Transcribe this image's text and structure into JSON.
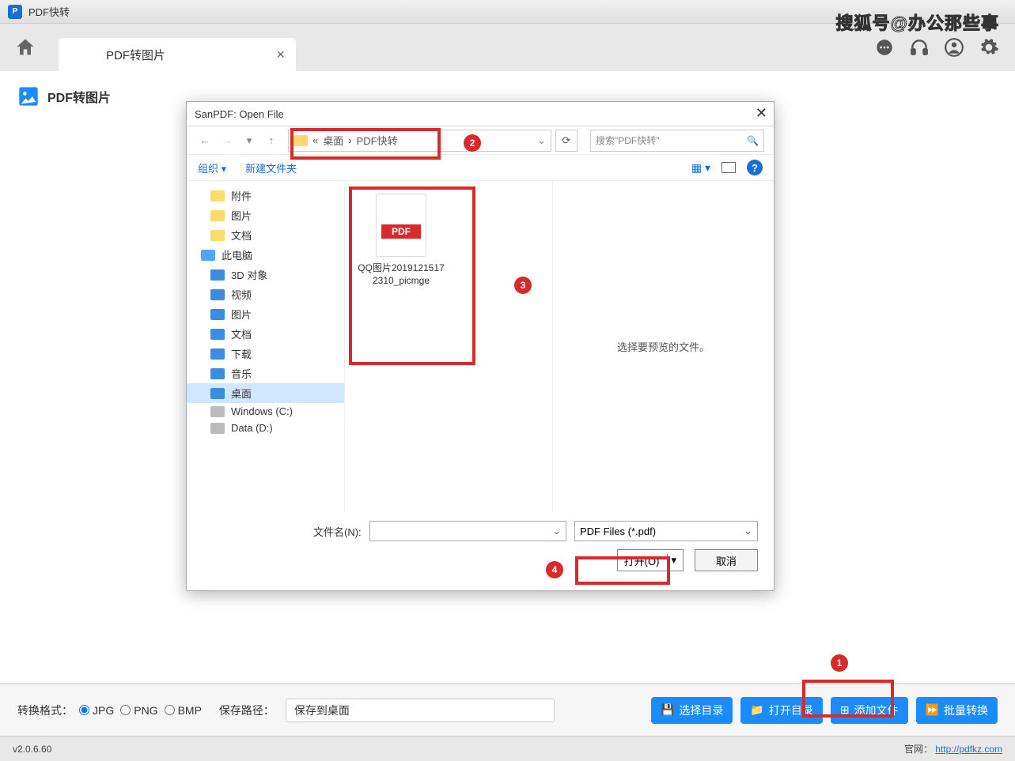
{
  "app": {
    "title": "PDF快转"
  },
  "watermark": "搜狐号@办公那些事",
  "tab": {
    "label": "PDF转图片"
  },
  "section": {
    "title": "PDF转图片"
  },
  "toolbar_icons": [
    "chat",
    "headphones",
    "user",
    "gear"
  ],
  "dialog": {
    "title": "SanPDF: Open File",
    "breadcrumb": {
      "prefix": "«",
      "parts": [
        "桌面",
        "PDF快转"
      ]
    },
    "search_placeholder": "搜索\"PDF快转\"",
    "organize": "组织",
    "new_folder": "新建文件夹",
    "tree": [
      {
        "label": "附件",
        "icon": "folder",
        "level": 1
      },
      {
        "label": "图片",
        "icon": "folder",
        "level": 1
      },
      {
        "label": "文档",
        "icon": "folder",
        "level": 1
      },
      {
        "label": "此电脑",
        "icon": "pc",
        "level": 0
      },
      {
        "label": "3D 对象",
        "icon": "blue",
        "level": 1
      },
      {
        "label": "视频",
        "icon": "blue",
        "level": 1
      },
      {
        "label": "图片",
        "icon": "blue",
        "level": 1
      },
      {
        "label": "文档",
        "icon": "blue",
        "level": 1
      },
      {
        "label": "下载",
        "icon": "blue",
        "level": 1
      },
      {
        "label": "音乐",
        "icon": "blue",
        "level": 1
      },
      {
        "label": "桌面",
        "icon": "mon",
        "level": 1,
        "selected": true
      },
      {
        "label": "Windows (C:)",
        "icon": "drv",
        "level": 1
      },
      {
        "label": "Data (D:)",
        "icon": "drv",
        "level": 1
      }
    ],
    "file": {
      "name": "QQ图片20191215172310_picmge"
    },
    "preview_msg": "选择要预览的文件。",
    "filename_label": "文件名(N):",
    "filetype": "PDF Files (*.pdf)",
    "open_btn": "打开(O)",
    "cancel_btn": "取消"
  },
  "bottom": {
    "format_label": "转换格式：",
    "formats": [
      "JPG",
      "PNG",
      "BMP"
    ],
    "save_label": "保存路径：",
    "save_value": "保存到桌面",
    "buttons": {
      "choose_dir": "选择目录",
      "open_dir": "打开目录",
      "add_file": "添加文件",
      "batch": "批量转换"
    }
  },
  "status": {
    "version": "v2.0.6.60",
    "site_label": "官网：",
    "site_url": "http://pdfkz.com"
  },
  "badges": {
    "b1": "1",
    "b2": "2",
    "b3": "3",
    "b4": "4"
  }
}
